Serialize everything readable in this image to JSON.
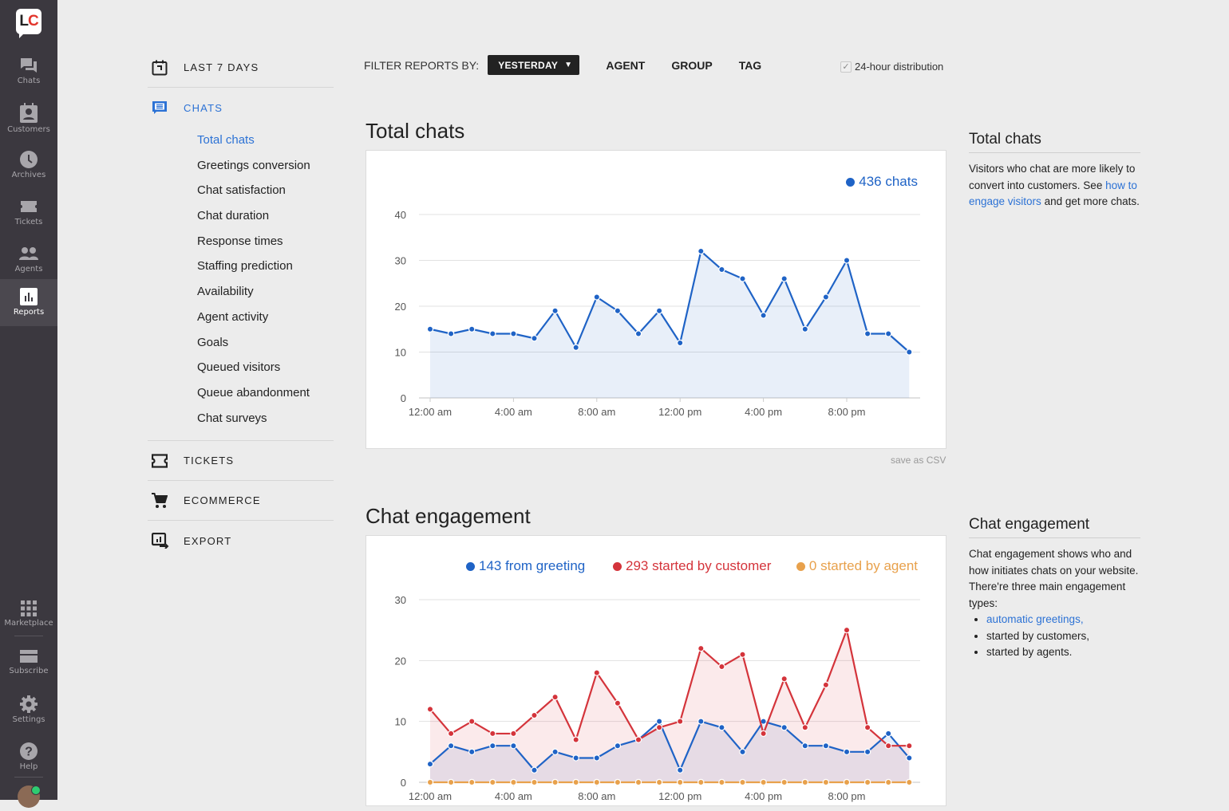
{
  "nav": {
    "logo": {
      "l": "L",
      "c": "C"
    },
    "items": [
      {
        "label": "Chats",
        "icon": "chat-bubbles-icon"
      },
      {
        "label": "Customers",
        "icon": "customer-card-icon"
      },
      {
        "label": "Archives",
        "icon": "clock-icon"
      },
      {
        "label": "Tickets",
        "icon": "ticket-icon"
      },
      {
        "label": "Agents",
        "icon": "agents-icon"
      },
      {
        "label": "Reports",
        "icon": "bar-chart-icon",
        "active": true
      }
    ],
    "bottom_items": [
      {
        "label": "Marketplace",
        "icon": "grid-icon"
      },
      {
        "label": "Subscribe",
        "icon": "credit-card-icon"
      },
      {
        "label": "Settings",
        "icon": "gear-icon"
      },
      {
        "label": "Help",
        "icon": "help-icon"
      }
    ]
  },
  "menu": {
    "sections": [
      {
        "label": "LAST 7 DAYS",
        "icon": "calendar-icon"
      },
      {
        "label": "CHATS",
        "icon": "chat-report-icon",
        "active": true
      },
      {
        "label": "TICKETS",
        "icon": "ticket-icon"
      },
      {
        "label": "ECOMMERCE",
        "icon": "cart-icon"
      },
      {
        "label": "EXPORT",
        "icon": "export-icon"
      }
    ],
    "chats_items": [
      "Total chats",
      "Greetings conversion",
      "Chat satisfaction",
      "Chat duration",
      "Response times",
      "Staffing prediction",
      "Availability",
      "Agent activity",
      "Goals",
      "Queued visitors",
      "Queue abandonment",
      "Chat surveys"
    ],
    "active_item": "Total chats"
  },
  "filter": {
    "label": "FILTER REPORTS BY:",
    "selected": "YESTERDAY",
    "options": [
      "AGENT",
      "GROUP",
      "TAG"
    ],
    "distribution_label": "24-hour distribution",
    "distribution_checked": true
  },
  "colors": {
    "accent": "#2c72d5",
    "blue": "#1f63c6",
    "red": "#d4343b",
    "orange": "#e8a14c"
  },
  "total": {
    "title": "Total chats",
    "legend": "436 chats",
    "save_csv": "save as CSV",
    "side_title": "Total chats",
    "side_text_1": "Visitors who chat are more likely to convert into customers. See ",
    "side_link": "how to engage visitors",
    "side_text_2": " and get more chats."
  },
  "engagement": {
    "title": "Chat engagement",
    "legend": [
      "143 from greeting",
      "293 started by customer",
      "0 started by agent"
    ],
    "side_title": "Chat engagement",
    "side_text": "Chat engagement shows who and how initiates chats on your website. There're three main engagement types:",
    "side_list_link": "automatic greetings,",
    "side_list": [
      "started by customers,",
      "started by agents."
    ]
  },
  "chart_data": [
    {
      "type": "area",
      "title": "Total chats",
      "x": [
        "12am",
        "1am",
        "2am",
        "3am",
        "4am",
        "5am",
        "6am",
        "7am",
        "8am",
        "9am",
        "10am",
        "11am",
        "12pm",
        "1pm",
        "2pm",
        "3pm",
        "4pm",
        "5pm",
        "6pm",
        "7pm",
        "8pm",
        "9pm",
        "10pm",
        "11pm"
      ],
      "xticks": [
        "12:00 am",
        "4:00 am",
        "8:00 am",
        "12:00 pm",
        "4:00 pm",
        "8:00 pm"
      ],
      "yticks": [
        0,
        10,
        20,
        30,
        40
      ],
      "ylim": [
        0,
        40
      ],
      "grid": true,
      "legend_position": "top-right",
      "series": [
        {
          "name": "436 chats",
          "color": "#1f63c6",
          "values": [
            15,
            14,
            15,
            14,
            14,
            13,
            19,
            11,
            22,
            19,
            14,
            19,
            12,
            32,
            28,
            26,
            18,
            26,
            15,
            22,
            30,
            14,
            14,
            10
          ]
        }
      ]
    },
    {
      "type": "area",
      "title": "Chat engagement",
      "x": [
        "12am",
        "1am",
        "2am",
        "3am",
        "4am",
        "5am",
        "6am",
        "7am",
        "8am",
        "9am",
        "10am",
        "11am",
        "12pm",
        "1pm",
        "2pm",
        "3pm",
        "4pm",
        "5pm",
        "6pm",
        "7pm",
        "8pm",
        "9pm",
        "10pm",
        "11pm"
      ],
      "xticks": [
        "12:00 am",
        "4:00 am",
        "8:00 am",
        "12:00 pm",
        "4:00 pm",
        "8:00 pm"
      ],
      "yticks": [
        0,
        10,
        20,
        30
      ],
      "ylim": [
        0,
        30
      ],
      "grid": true,
      "legend_position": "top",
      "series": [
        {
          "name": "143 from greeting",
          "color": "#1f63c6",
          "values": [
            3,
            6,
            5,
            6,
            6,
            2,
            5,
            4,
            4,
            6,
            7,
            10,
            2,
            10,
            9,
            5,
            10,
            9,
            6,
            6,
            5,
            5,
            8,
            4
          ]
        },
        {
          "name": "293 started by customer",
          "color": "#d4343b",
          "values": [
            12,
            8,
            10,
            8,
            8,
            11,
            14,
            7,
            18,
            13,
            7,
            9,
            10,
            22,
            19,
            21,
            8,
            17,
            9,
            16,
            25,
            9,
            6,
            6
          ]
        },
        {
          "name": "0 started by agent",
          "color": "#e8a14c",
          "values": [
            0,
            0,
            0,
            0,
            0,
            0,
            0,
            0,
            0,
            0,
            0,
            0,
            0,
            0,
            0,
            0,
            0,
            0,
            0,
            0,
            0,
            0,
            0,
            0
          ]
        }
      ]
    }
  ]
}
